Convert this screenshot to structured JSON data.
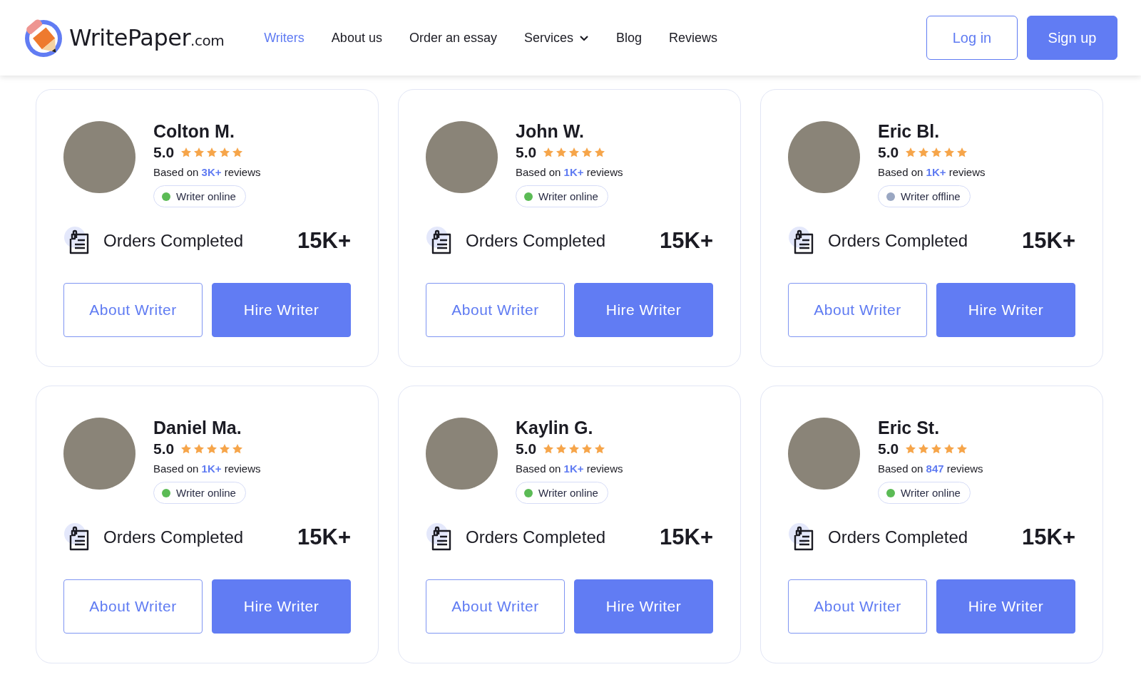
{
  "header": {
    "logo": {
      "name": "WritePaper",
      "suffix": ".com"
    },
    "nav": [
      {
        "label": "Writers",
        "selected": true,
        "dropdown": false
      },
      {
        "label": "About us",
        "selected": false,
        "dropdown": false
      },
      {
        "label": "Order an essay",
        "selected": false,
        "dropdown": false
      },
      {
        "label": "Services",
        "selected": false,
        "dropdown": true
      },
      {
        "label": "Blog",
        "selected": false,
        "dropdown": false
      },
      {
        "label": "Reviews",
        "selected": false,
        "dropdown": false
      }
    ],
    "login": "Log in",
    "signup": "Sign up"
  },
  "writers": [
    {
      "name": "Colton M.",
      "rating": "5.0",
      "stars": 5,
      "reviews": "Based on **3K+** reviews",
      "status": "Writer online",
      "online": true,
      "orders_label": "Orders Completed",
      "orders": "15K+",
      "about": "About Writer",
      "hire": "Hire Writer"
    },
    {
      "name": "John W.",
      "rating": "5.0",
      "stars": 5,
      "reviews": "Based on **1K+** reviews",
      "status": "Writer online",
      "online": true,
      "orders_label": "Orders Completed",
      "orders": "15K+",
      "about": "About Writer",
      "hire": "Hire Writer"
    },
    {
      "name": "Eric Bl.",
      "rating": "5.0",
      "stars": 5,
      "reviews": "Based on **1K+** reviews",
      "status": "Writer offline",
      "online": false,
      "orders_label": "Orders Completed",
      "orders": "15K+",
      "about": "About Writer",
      "hire": "Hire Writer"
    },
    {
      "name": "Daniel Ma.",
      "rating": "5.0",
      "stars": 5,
      "reviews": "Based on **1K+** reviews",
      "status": "Writer online",
      "online": true,
      "orders_label": "Orders Completed",
      "orders": "15K+",
      "about": "About Writer",
      "hire": "Hire Writer"
    },
    {
      "name": "Kaylin G.",
      "rating": "5.0",
      "stars": 5,
      "reviews": "Based on **1K+** reviews",
      "status": "Writer online",
      "online": true,
      "orders_label": "Orders Completed",
      "orders": "15K+",
      "about": "About Writer",
      "hire": "Hire Writer"
    },
    {
      "name": "Eric St.",
      "rating": "5.0",
      "stars": 5,
      "reviews": "Based on **847** reviews",
      "status": "Writer online",
      "online": true,
      "orders_label": "Orders Completed",
      "orders": "15K+",
      "about": "About Writer",
      "hire": "Hire Writer"
    }
  ]
}
